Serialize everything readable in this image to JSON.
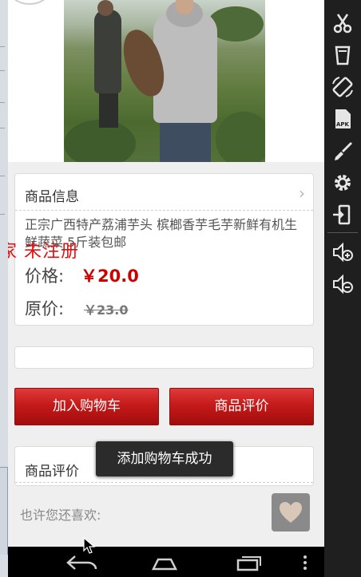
{
  "product": {
    "info_title": "商品信息",
    "name": "正宗广西特产荔浦芋头 槟榔香芋毛芋新鲜有机生鲜蔬菜 5斤装包邮",
    "price_label": "价格:",
    "price": "￥20.0",
    "original_price_label": "原价:",
    "original_price": "￥23.0"
  },
  "watermark": "家 未注册",
  "buttons": {
    "add_to_cart": "加入购物车",
    "reviews": "商品评价"
  },
  "reviews_section": {
    "title": "商品评价"
  },
  "recommend": {
    "label": "也许您还喜欢:"
  },
  "toast": "添加购物车成功",
  "icons": {
    "sidebar": [
      "scissors-icon",
      "trash-icon",
      "rotate-screen-icon",
      "apk-icon",
      "brush-icon",
      "gear-icon",
      "import-icon",
      "volume-up-icon",
      "volume-down-icon"
    ],
    "nav": [
      "back-icon",
      "home-icon",
      "recent-apps-icon",
      "menu-icon"
    ]
  },
  "colors": {
    "accent_red": "#cc0000",
    "button_red": "#c51a1a",
    "watermark_red": "#e01010"
  }
}
